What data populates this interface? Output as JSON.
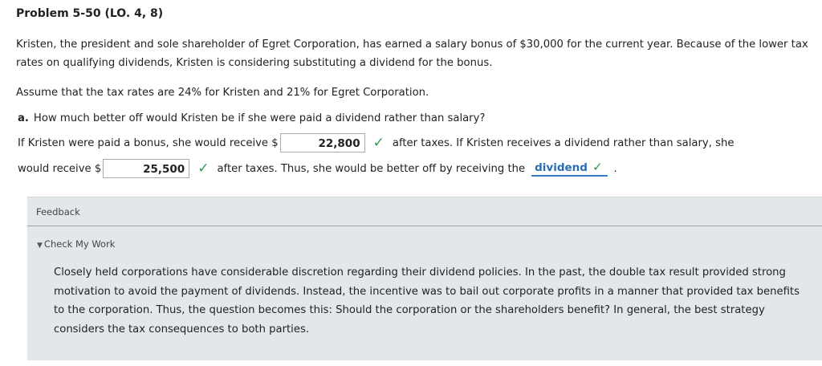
{
  "problem": {
    "title": "Problem 5-50 (LO. 4, 8)",
    "paragraph1": "Kristen, the president and sole shareholder of Egret Corporation, has earned a salary bonus of $30,000 for the current year. Because of the lower tax rates on qualifying dividends, Kristen is considering substituting a dividend for the bonus.",
    "paragraph2": "Assume that the tax rates are 24% for Kristen and 21% for Egret Corporation."
  },
  "question_a": {
    "letter": "a.",
    "text": "How much better off would Kristen be if she were paid a dividend rather than salary?",
    "line1_before": "If Kristen were paid a bonus, she would receive $",
    "answer1": "22,800",
    "line1_after": "after taxes. If Kristen receives a dividend rather than salary, she",
    "line2_before": "would receive $",
    "answer2": "25,500",
    "line2_after": "after taxes. Thus, she would be better off by receiving the",
    "answer3": "dividend",
    "period": "."
  },
  "icons": {
    "check": "✓",
    "caret_down": "▼",
    "triangle_down": "▼"
  },
  "feedback": {
    "label": "Feedback",
    "check_my_work": "Check My Work",
    "explanation": "Closely held corporations have considerable discretion regarding their dividend policies. In the past, the double tax result provided strong motivation to avoid the payment of dividends. Instead, the incentive was to bail out corporate profits in a manner that provided tax benefits to the corporation. Thus, the question becomes this: Should the corporation or the shareholders benefit? In general, the best strategy considers the tax consequences to both parties."
  },
  "colors": {
    "check_green": "#2f9a4a",
    "dropdown_blue": "#2b6cb5",
    "feedback_bg": "#e2e7ea"
  }
}
